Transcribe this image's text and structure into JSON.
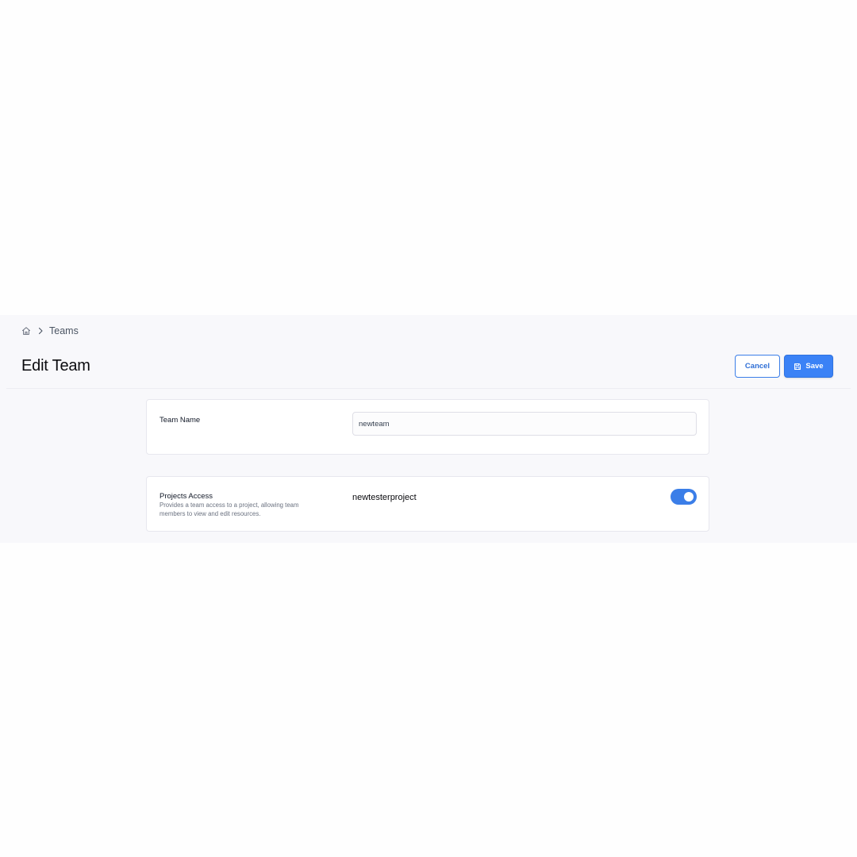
{
  "breadcrumb": {
    "home_icon": "home-icon",
    "separator_icon": "chevron-right-icon",
    "items": [
      "Teams"
    ]
  },
  "page": {
    "title": "Edit Team"
  },
  "actions": {
    "cancel_label": "Cancel",
    "save_label": "Save",
    "save_icon": "floppy-disk-icon"
  },
  "team_name": {
    "label": "Team Name",
    "value": "newteam"
  },
  "projects_access": {
    "label": "Projects Access",
    "description": "Provides a team access to a project, allowing team members to view and edit resources.",
    "projects": [
      {
        "name": "newtesterproject",
        "enabled": true
      }
    ]
  },
  "colors": {
    "accent": "#3b82f6",
    "page_background": "#f8f8fb",
    "card_background": "#ffffff"
  }
}
